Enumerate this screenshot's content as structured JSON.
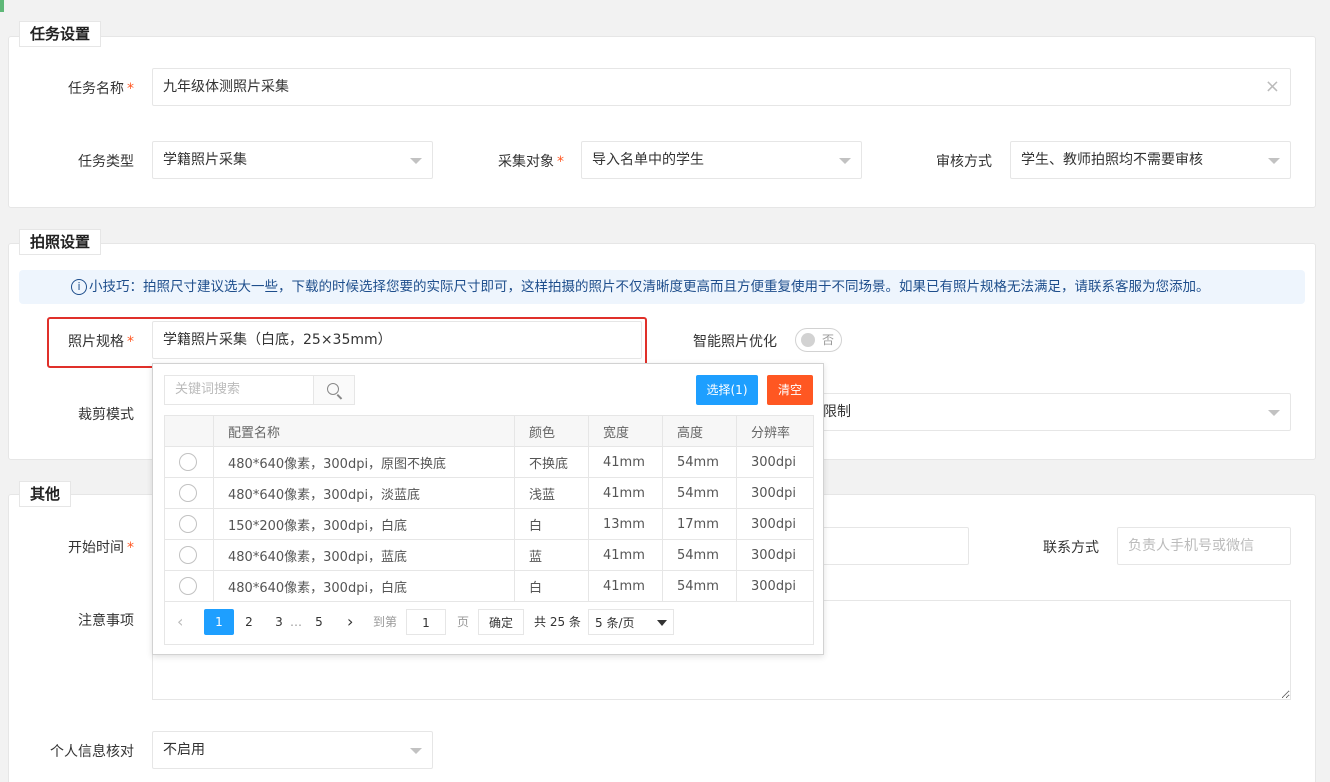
{
  "task_settings": {
    "legend": "任务设置",
    "name_label": "任务名称",
    "name_value": "九年级体测照片采集",
    "clear_glyph": "×",
    "type_label": "任务类型",
    "type_value": "学籍照片采集",
    "target_label": "采集对象",
    "target_value": "导入名单中的学生",
    "review_label": "审核方式",
    "review_value": "学生、教师拍照均不需要审核",
    "required_mark": "*"
  },
  "photo_settings": {
    "legend": "拍照设置",
    "tip_icon": "i",
    "tip_text": "小技巧：拍照尺寸建议选大一些，下载的时候选择您要的实际尺寸即可，这样拍摄的照片不仅清晰度更高而且方便重复使用于不同场景。如果已有照片规格无法满足，请联系客服为您添加。",
    "spec_label": "照片规格",
    "spec_value": "学籍照片采集（白底，25×35mm）",
    "smart_label": "智能照片优化",
    "smart_switch_text": "否",
    "crop_label": "裁剪模式",
    "crop_value_partial": "限制"
  },
  "spec_dropdown": {
    "search_placeholder": "关键词搜索",
    "select_button": "选择(1)",
    "clear_button": "清空",
    "columns": [
      "配置名称",
      "颜色",
      "宽度",
      "高度",
      "分辨率"
    ],
    "rows": [
      [
        "480*640像素，300dpi，原图不换底",
        "不换底",
        "41mm",
        "54mm",
        "300dpi"
      ],
      [
        "480*640像素，300dpi，淡蓝底",
        "浅蓝",
        "41mm",
        "54mm",
        "300dpi"
      ],
      [
        "150*200像素，300dpi，白底",
        "白",
        "13mm",
        "17mm",
        "300dpi"
      ],
      [
        "480*640像素，300dpi，蓝底",
        "蓝",
        "41mm",
        "54mm",
        "300dpi"
      ],
      [
        "480*640像素，300dpi，白底",
        "白",
        "41mm",
        "54mm",
        "300dpi"
      ]
    ],
    "pager": {
      "prev": "‹",
      "pages": [
        "1",
        "2",
        "3",
        "…",
        "5"
      ],
      "current": "1",
      "next": "›",
      "goto_label": "到第",
      "goto_value": "1",
      "page_unit": "页",
      "confirm": "确定",
      "total": "共 25 条",
      "per_page": "5 条/页"
    }
  },
  "other": {
    "legend": "其他",
    "start_label": "开始时间",
    "contact_label": "联系方式",
    "contact_placeholder": "负责人手机号或微信",
    "notes_label": "注意事项",
    "verify_label": "个人信息核对",
    "verify_value": "不启用"
  },
  "colors": {
    "accent_blue": "#1e9fff",
    "danger_orange": "#ff5722",
    "highlight_red": "#e0302a",
    "top_green": "#5fb878"
  }
}
